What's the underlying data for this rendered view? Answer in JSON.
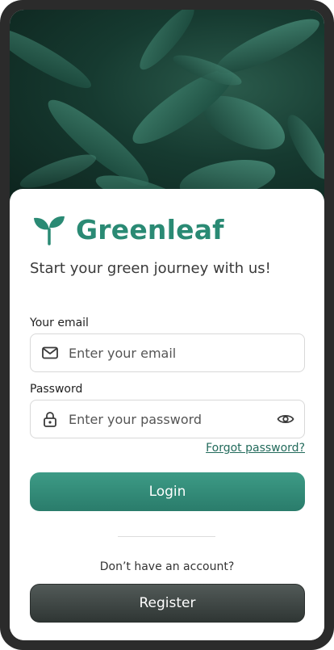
{
  "brand": {
    "name": "Greenleaf",
    "tagline": "Start your green journey with us!"
  },
  "email": {
    "label": "Your email",
    "placeholder": "Enter your email",
    "value": ""
  },
  "password": {
    "label": "Password",
    "placeholder": "Enter your password",
    "value": ""
  },
  "links": {
    "forgot_password": "Forgot password?"
  },
  "buttons": {
    "login": "Login",
    "register": "Register"
  },
  "footer": {
    "no_account": "Don’t have an account?"
  },
  "icons": {
    "logo": "sprout-icon",
    "email": "mail-icon",
    "password": "lock-icon",
    "visibility": "eye-icon"
  },
  "colors": {
    "brand": "#2a8a74",
    "login_button": "#338c78",
    "register_button": "#3f4745",
    "link": "#236b5c"
  }
}
